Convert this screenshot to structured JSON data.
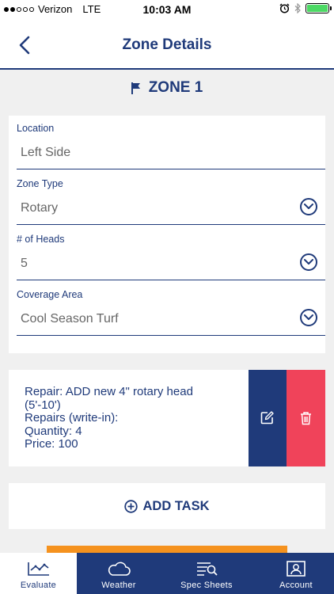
{
  "status_bar": {
    "carrier": "Verizon",
    "network": "LTE",
    "time": "10:03 AM"
  },
  "nav": {
    "title": "Zone Details"
  },
  "zone": {
    "title": "ZONE 1"
  },
  "form": {
    "fields": [
      {
        "label": "Location",
        "value": "Left Side"
      },
      {
        "label": "Zone Type",
        "value": "Rotary"
      },
      {
        "label": "# of Heads",
        "value": "5"
      },
      {
        "label": "Coverage Area",
        "value": "Cool Season Turf"
      }
    ]
  },
  "task": {
    "lines": [
      "Repair: ADD new 4\" rotary head",
      "(5'-10')",
      "Repairs (write-in):",
      "Quantity: 4",
      "Price: 100"
    ]
  },
  "add_task": {
    "label": "ADD TASK"
  },
  "tabs": [
    {
      "label": "Evaluate",
      "icon": "chart-icon",
      "active": true
    },
    {
      "label": "Weather",
      "icon": "cloud-icon",
      "active": false
    },
    {
      "label": "Spec Sheets",
      "icon": "spec-sheet-icon",
      "active": false
    },
    {
      "label": "Account",
      "icon": "account-icon",
      "active": false
    }
  ],
  "colors": {
    "primary": "#1f3a7a",
    "delete": "#f0435a",
    "accent": "#f5921e",
    "background": "#f0f0f0"
  }
}
